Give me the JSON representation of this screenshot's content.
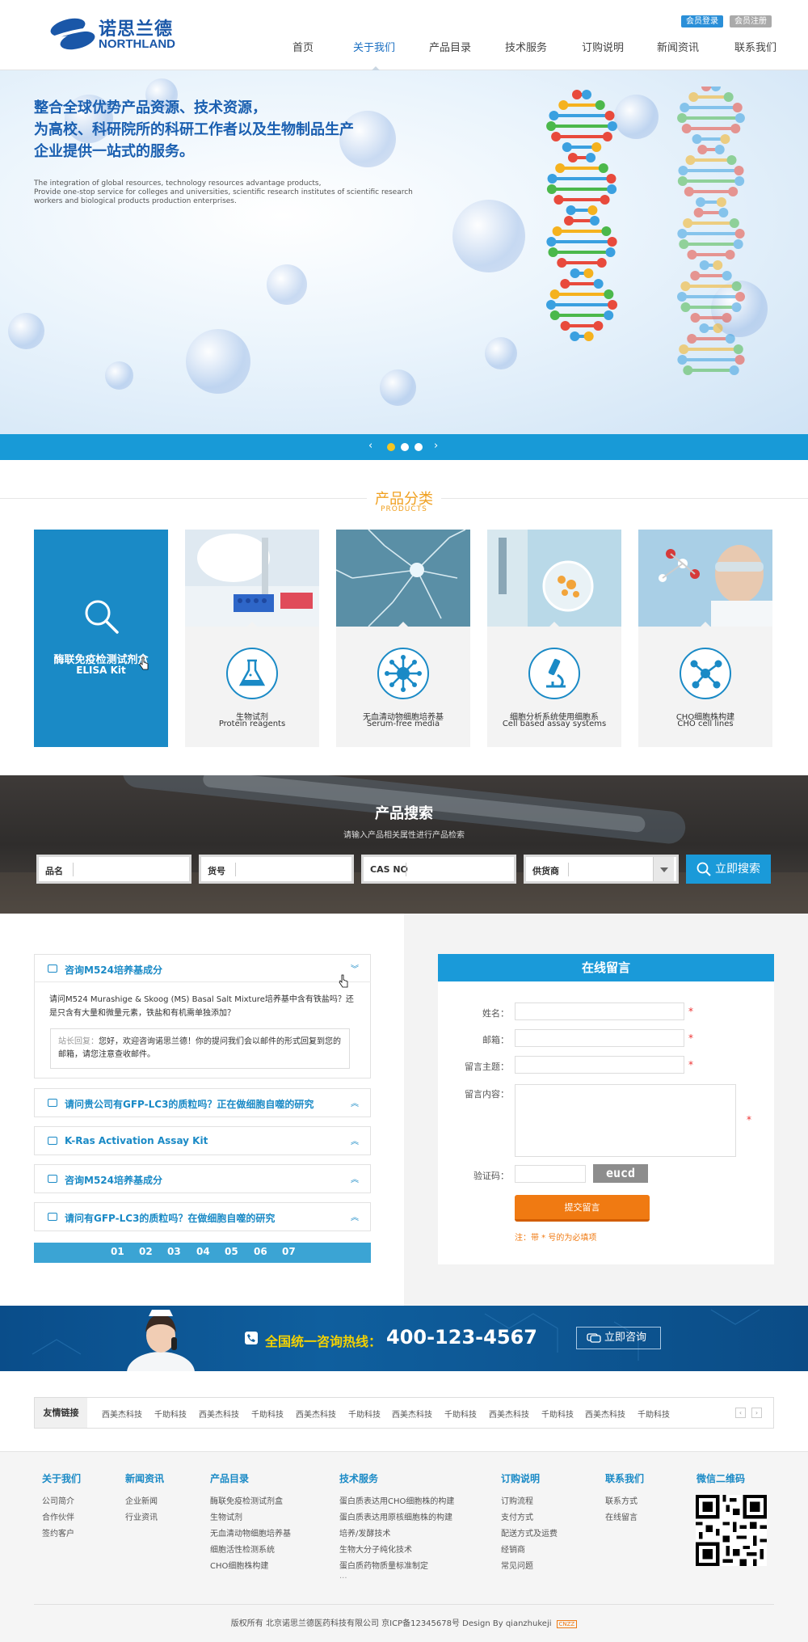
{
  "header": {
    "logo_cn": "诺思兰德",
    "logo_en": "NORTHLAND",
    "login_label": "会员登录",
    "register_label": "会员注册",
    "nav": [
      "首页",
      "关于我们",
      "产品目录",
      "技术服务",
      "订购说明",
      "新闻资讯",
      "联系我们"
    ],
    "active_nav": "关于我们"
  },
  "banner": {
    "headline": [
      "整合全球优势产品资源、技术资源，",
      "为高校、科研院所的科研工作者以及生物制品生产",
      "企业提供一站式的服务。"
    ],
    "english": [
      "The integration of global resources, technology resources advantage products,",
      "Provide one-stop service for colleges and universities, scientific research institutes of scientific research",
      "workers and biological products production enterprises."
    ],
    "slides_total": 3,
    "slide_active": 1,
    "prev_label": "‹",
    "next_label": "›"
  },
  "products": {
    "title": "产品分类",
    "subtitle": "PRODUCTS",
    "featured": {
      "cn": "酶联免疫检测试剂盒",
      "en": "ELISA Kit",
      "icon": "search-icon"
    },
    "items": [
      {
        "cn": "生物试剂",
        "en": "Protein reagents",
        "icon": "flask-icon"
      },
      {
        "cn": "无血清动物细胞培养基",
        "en": "Serum-free media",
        "icon": "cell-icon"
      },
      {
        "cn": "细胞分析系统使用细胞系",
        "en": "Cell based assay systems",
        "icon": "microscope-icon"
      },
      {
        "cn": "CHO细胞株构建",
        "en": "CHO cell lines",
        "icon": "molecule-icon"
      }
    ]
  },
  "search": {
    "title": "产品搜索",
    "subtitle": "请输入产品相关属性进行产品检索",
    "fields": [
      {
        "label": "品名",
        "value": ""
      },
      {
        "label": "货号",
        "value": ""
      },
      {
        "label": "CAS NO",
        "value": ""
      },
      {
        "label": "供货商",
        "value": ""
      }
    ],
    "button_label": "立即搜索"
  },
  "faq": {
    "items": [
      {
        "question": "咨询M524培养基成分",
        "expanded": true
      },
      {
        "question": "请问贵公司有GFP-LC3的质粒吗？正在做细胞自噬的研究",
        "expanded": false
      },
      {
        "question": "K-Ras Activation Assay Kit",
        "expanded": false
      },
      {
        "question": "咨询M524培养基成分",
        "expanded": false
      },
      {
        "question": "请问有GFP-LC3的质粒吗？在做细胞自噬的研究",
        "expanded": false
      }
    ],
    "answer_question": "请问M524 Murashige & Skoog (MS) Basal Salt Mixture培养基中含有铁盐吗？还是只含有大量和微量元素，铁盐和有机需单独添加？",
    "reply_label": "站长回复：",
    "reply_text": "您好，欢迎咨询诺思兰德！你的提问我们会以邮件的形式回复到您的邮箱，请您注意查收邮件。",
    "pages": [
      "01",
      "02",
      "03",
      "04",
      "05",
      "06",
      "07"
    ]
  },
  "message": {
    "title": "在线留言",
    "labels": {
      "name": "姓名：",
      "email": "邮箱：",
      "subject": "留言主题：",
      "content": "留言内容：",
      "code": "验证码："
    },
    "values": {
      "name": "",
      "email": "",
      "subject": "",
      "content": "",
      "code": ""
    },
    "required_mark": "*",
    "captcha": "eucd",
    "submit_label": "提交留言",
    "note": "注：带 * 号的为必填项"
  },
  "hotline": {
    "label": "全国统一咨询热线：",
    "number": "400-123-4567",
    "consult_label": "立即咨询"
  },
  "links": {
    "label": "友情链接",
    "items": [
      "西美杰科技",
      "千助科技",
      "西美杰科技",
      "千助科技",
      "西美杰科技",
      "千助科技",
      "西美杰科技",
      "千助科技",
      "西美杰科技",
      "千助科技",
      "西美杰科技",
      "千助科技"
    ]
  },
  "footer": {
    "columns": [
      {
        "title": "关于我们",
        "items": [
          "公司简介",
          "合作伙伴",
          "签约客户"
        ]
      },
      {
        "title": "新闻资讯",
        "items": [
          "企业新闻",
          "行业资讯"
        ]
      },
      {
        "title": "产品目录",
        "items": [
          "酶联免疫检测试剂盒",
          "生物试剂",
          "无血清动物细胞培养基",
          "细胞活性检测系统",
          "CHO细胞株构建"
        ]
      },
      {
        "title": "技术服务",
        "items": [
          "蛋白质表达用CHO细胞株的构建",
          "蛋白质表达用原核细胞株的构建",
          "培养/发酵技术",
          "生物大分子纯化技术",
          "蛋白质药物质量标准制定",
          "..."
        ]
      },
      {
        "title": "订购说明",
        "items": [
          "订购流程",
          "支付方式",
          "配送方式及运费",
          "经销商",
          "常见问题"
        ]
      },
      {
        "title": "联系我们",
        "items": [
          "联系方式",
          "在线留言"
        ]
      },
      {
        "title": "微信二维码",
        "items": []
      }
    ],
    "copyright": "版权所有  北京诺思兰德医药科技有限公司  京ICP备12345678号  Design By qianzhukeji",
    "badge": "CNZZ"
  },
  "colors": {
    "brand_blue": "#1a8ac6",
    "accent_orange": "#f07a12",
    "banner_bar": "#189ad7"
  }
}
